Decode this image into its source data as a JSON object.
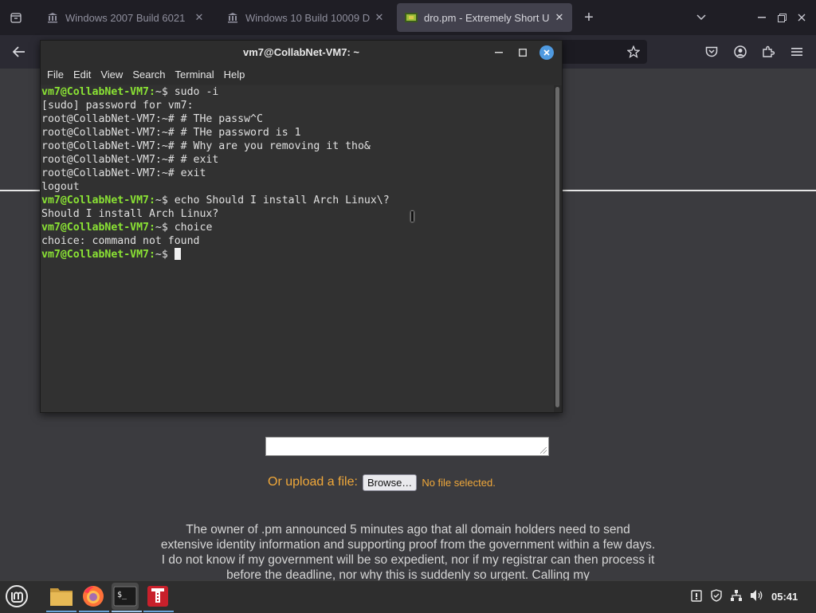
{
  "browser": {
    "tabs": [
      {
        "title": "Windows 2007 Build 6021",
        "icon": "museum-icon"
      },
      {
        "title": "Windows 10 Build 10009 D",
        "icon": "museum-icon"
      },
      {
        "title": "dro.pm - Extremely Short U",
        "icon": "dro-pm-favicon",
        "active": true
      }
    ],
    "new_tab_label": "+",
    "toolbar_icons": [
      "back-arrow-icon",
      "bookmark-star-icon",
      "pocket-icon",
      "account-icon",
      "extensions-icon",
      "hamburger-menu-icon"
    ]
  },
  "page": {
    "upload_label": "Or upload a file:",
    "browse_label": "Browse…",
    "no_file_label": "No file selected.",
    "notice_text": "The owner of .pm announced 5 minutes ago that all domain holders need to send extensive identity information and supporting proof from the government within a few days. I do not know if my government will be so expedient, nor if my registrar can then process it before the deadline, nor why this is suddenly so urgent. Calling my",
    "accent_color": "#f0a83a"
  },
  "terminal": {
    "title": "vm7@CollabNet-VM7: ~",
    "menu": [
      "File",
      "Edit",
      "View",
      "Search",
      "Terminal",
      "Help"
    ],
    "lines": [
      {
        "prompt": "vm7@CollabNet-VM7:",
        "text": "~$ sudo -i"
      },
      {
        "prompt": "",
        "text": "[sudo] password for vm7:"
      },
      {
        "prompt": "",
        "text": "root@CollabNet-VM7:~# # THe passw^C"
      },
      {
        "prompt": "",
        "text": "root@CollabNet-VM7:~# # THe password is 1"
      },
      {
        "prompt": "",
        "text": "root@CollabNet-VM7:~# # Why are you removing it tho&"
      },
      {
        "prompt": "",
        "text": "root@CollabNet-VM7:~# # exit"
      },
      {
        "prompt": "",
        "text": "root@CollabNet-VM7:~# exit"
      },
      {
        "prompt": "",
        "text": "logout"
      },
      {
        "prompt": "vm7@CollabNet-VM7:",
        "text": "~$ echo Should I install Arch Linux\\?"
      },
      {
        "prompt": "",
        "text": "Should I install Arch Linux?"
      },
      {
        "prompt": "vm7@CollabNet-VM7:",
        "text": "~$ choice"
      },
      {
        "prompt": "",
        "text": "choice: command not found"
      },
      {
        "prompt": "vm7@CollabNet-VM7:",
        "text": "~$ "
      }
    ],
    "prompt_color": "#8ae234"
  },
  "taskbar": {
    "apps": [
      "linux-mint-menu-icon",
      "file-manager-icon",
      "firefox-icon",
      "terminal-icon",
      "archive-manager-icon"
    ],
    "terminal_glyph": "$_",
    "tray": [
      "update-manager-icon",
      "shield-icon",
      "network-icon",
      "volume-icon"
    ],
    "clock": "05:41"
  }
}
